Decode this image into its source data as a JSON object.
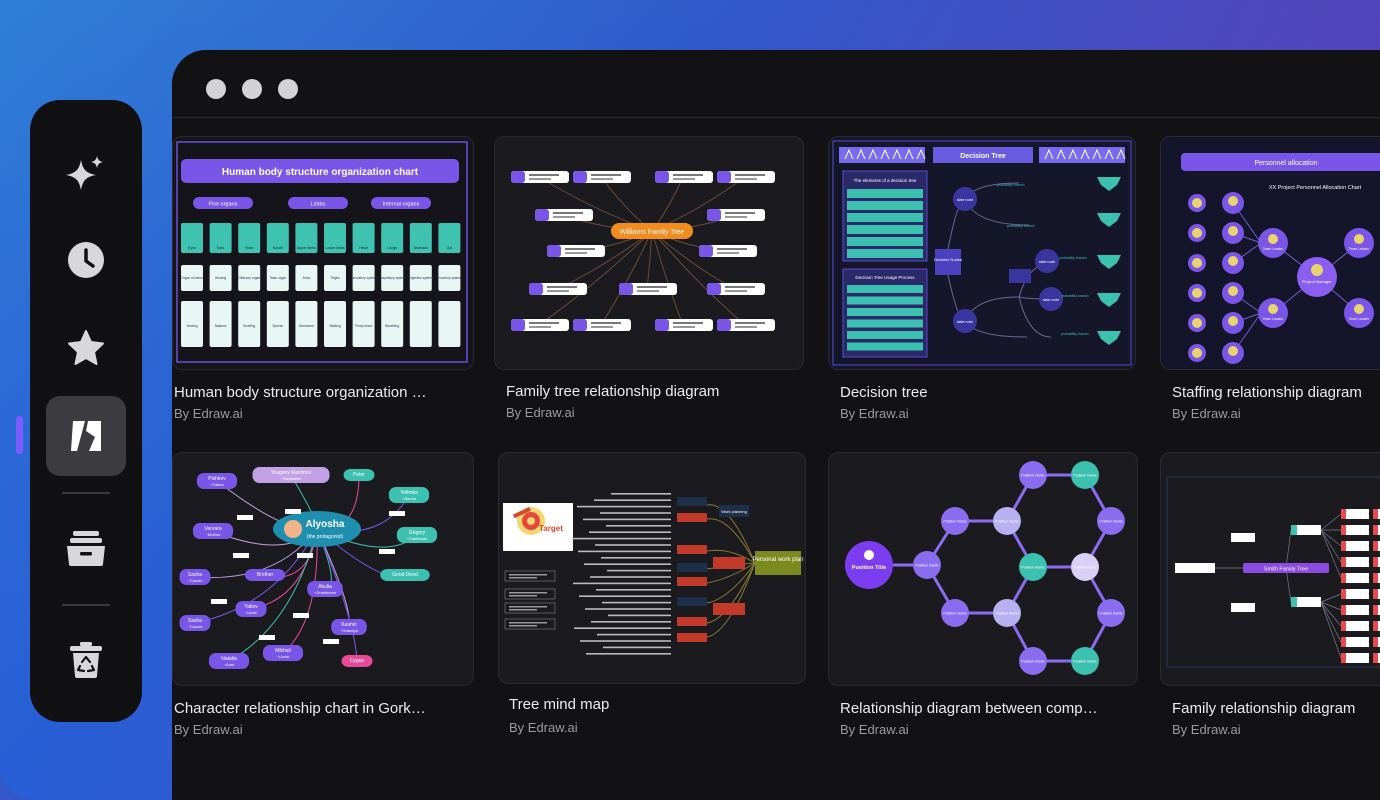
{
  "sidebar": {
    "items": [
      {
        "name": "ai-sparkle",
        "icon": "sparkle-icon"
      },
      {
        "name": "recent",
        "icon": "clock-icon"
      },
      {
        "name": "favorites",
        "icon": "star-icon"
      },
      {
        "name": "templates",
        "icon": "template-icon",
        "active": true
      },
      {
        "name": "files",
        "icon": "folder-icon"
      },
      {
        "name": "recycle-bin",
        "icon": "recycle-bin-icon"
      }
    ]
  },
  "accent_color": "#7c5cff",
  "templates": [
    {
      "title": "Human body structure organization …",
      "author": "By Edraw.ai",
      "thumb": {
        "heading": "Human body structure organization chart",
        "groups": [
          "Five organs",
          "Limbs",
          "Internal organs"
        ],
        "icon_labels": [
          "Eyes",
          "Ears",
          "Nose",
          "Mouth",
          "Upper limbs",
          "Lower limbs",
          "Heart",
          "Lungs",
          "Stomach",
          "Gut"
        ],
        "row2": [
          "Organ of vision",
          "Hearing",
          "Olfactory organ",
          "Taste organ",
          "Arms",
          "Thighs",
          "Circulatory system",
          "Respiratory system",
          "Digestive system",
          "Excretory system"
        ],
        "row3": [
          "Viewing",
          "Balance",
          "Smelling",
          "Speech",
          "Movement",
          "Walking",
          "Pump blood",
          "Breathing",
          "",
          ""
        ]
      }
    },
    {
      "title": "Family tree relationship diagram",
      "author": "By Edraw.ai",
      "thumb": {
        "center": "Williams Family Tree"
      }
    },
    {
      "title": "Decision tree",
      "author": "By Edraw.ai",
      "thumb": {
        "heading": "Decision Tree",
        "panel1": "The elements of a decision tree",
        "panel2": "Decision Tree Usage Process",
        "decision": "Decision Nodes",
        "state": "state node",
        "prob": "probability branch",
        "result": "result node"
      }
    },
    {
      "title": "Staffing relationship diagram",
      "author": "By Edraw.ai",
      "thumb": {
        "heading": "Personnel allocation",
        "subheading": "XX Project Personnel Allocation Chart",
        "center": "Project Manager",
        "team": "Team Leader",
        "member": "Group member"
      }
    },
    {
      "title": "Character relationship chart in Gork…",
      "author": "By Edraw.ai",
      "thumb": {
        "center": "Alyosha",
        "center_sub": "(the protagonist)",
        "names": [
          "Pishkov",
          "Yevgeny Maximov",
          "Peter",
          "Yefimka",
          "Varvara",
          "Grigory",
          "Brother",
          "Good Deed",
          "Sasha",
          "Akulia",
          "Yakov",
          "Sasha",
          "Kashin",
          "Natalia",
          "Mikhail",
          "Cygan"
        ],
        "roles": [
          "~Father",
          "~Stepfather",
          "",
          "~Barmy",
          "~Mother",
          "~Craftsman",
          "",
          "",
          "~Cousin",
          "~Grandmom",
          "~Uncle",
          "~Cousin",
          "~Grandpa",
          "~Aunt",
          "~Uncle",
          ""
        ]
      }
    },
    {
      "title": "Tree mind map",
      "author": "By Edraw.ai",
      "thumb": {
        "target": "Target",
        "center": "Personal work plan",
        "work": "Work planning"
      }
    },
    {
      "title": "Relationship diagram between comp…",
      "author": "By Edraw.ai",
      "thumb": {
        "center": "Position Title",
        "node": "Position Name"
      }
    },
    {
      "title": "Family relationship diagram",
      "author": "By Edraw.ai",
      "thumb": {
        "center": "Smith Family Tree"
      }
    }
  ]
}
